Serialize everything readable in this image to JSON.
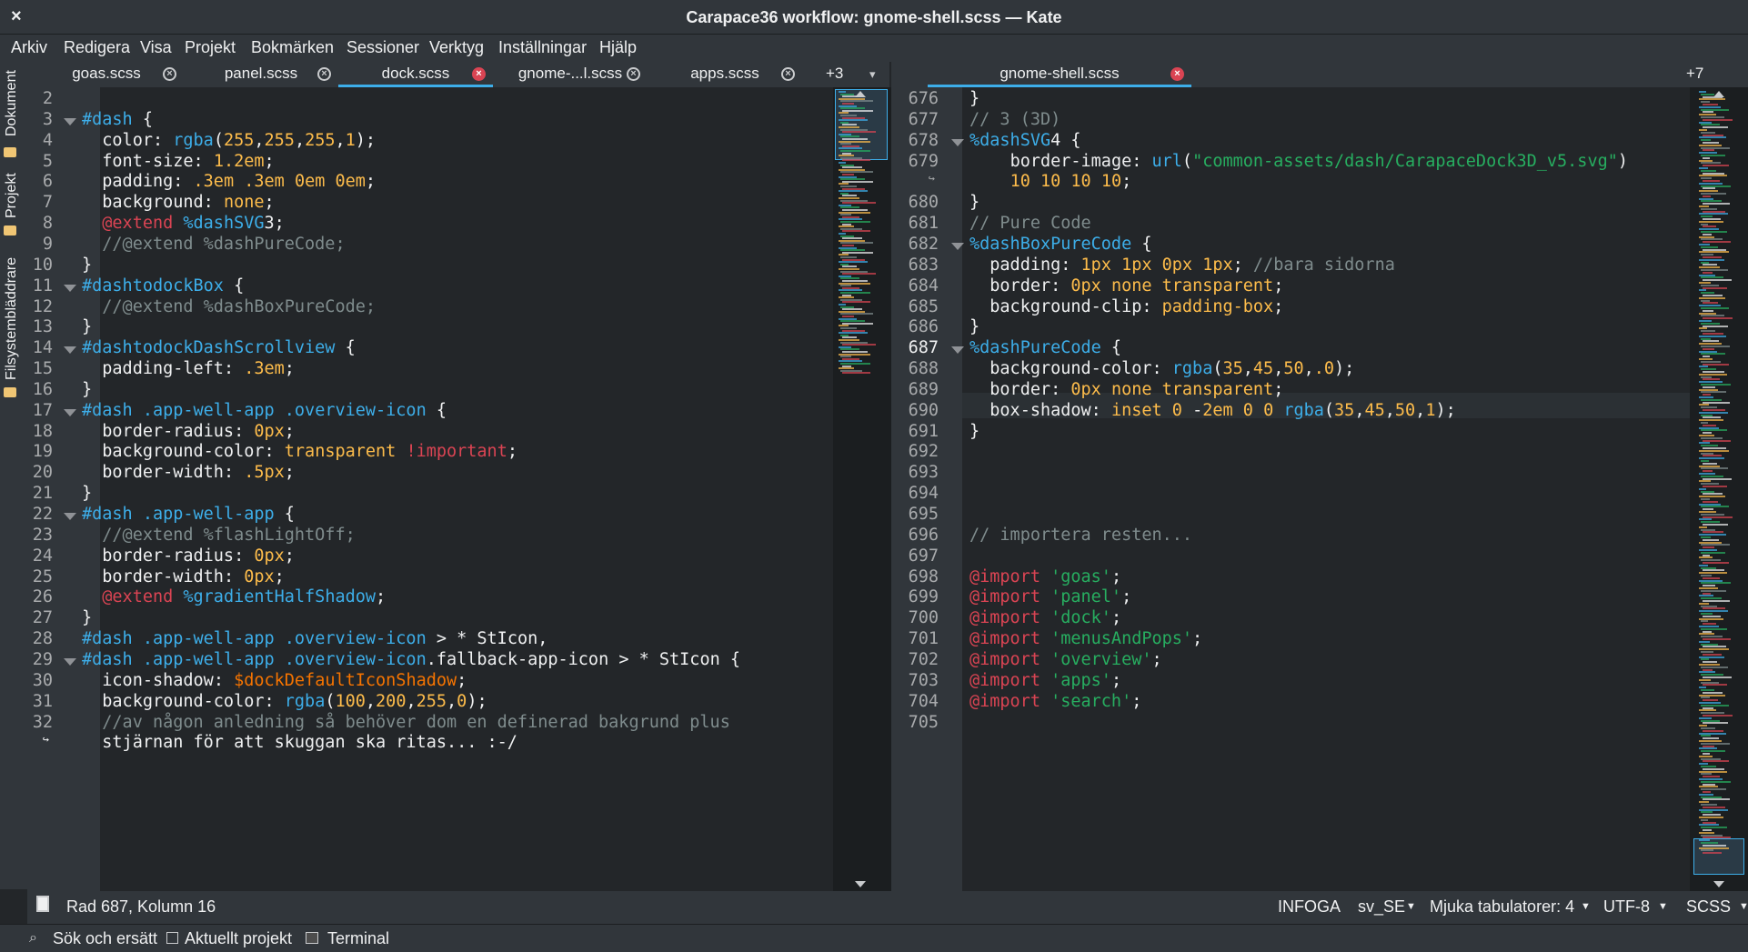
{
  "window": {
    "title": "Carapace36 workflow: gnome-shell.scss — Kate",
    "close": "×"
  },
  "menu": [
    "Arkiv",
    "Redigera",
    "Visa",
    "Projekt",
    "Bokmärken",
    "Sessioner",
    "Verktyg",
    "Inställningar",
    "Hjälp"
  ],
  "sidebar": [
    "Dokument",
    "Projekt",
    "Filsystembläddrare"
  ],
  "left_tabs": [
    {
      "label": "goas.scss",
      "modified": false
    },
    {
      "label": "panel.scss",
      "modified": false
    },
    {
      "label": "dock.scss",
      "modified": true
    },
    {
      "label": "gnome-...l.scss",
      "modified": false
    },
    {
      "label": "apps.scss",
      "modified": false
    }
  ],
  "left_tabs_more": "+3",
  "right_tabs": [
    {
      "label": "gnome-shell.scss",
      "modified": true
    }
  ],
  "right_tabs_more": "+7",
  "left_editor": {
    "lines": [
      {
        "n": "2",
        "t": ""
      },
      {
        "n": "3",
        "t": "#dash {"
      },
      {
        "n": "4",
        "t": "  color: rgba(255,255,255,1);"
      },
      {
        "n": "5",
        "t": "  font-size: 1.2em;"
      },
      {
        "n": "6",
        "t": "  padding: .3em .3em 0em 0em;"
      },
      {
        "n": "7",
        "t": "  background: none;"
      },
      {
        "n": "8",
        "t": "  @extend %dashSVG3;"
      },
      {
        "n": "9",
        "t": "  //@extend %dashPureCode;"
      },
      {
        "n": "10",
        "t": "}"
      },
      {
        "n": "11",
        "t": "#dashtodockBox {"
      },
      {
        "n": "12",
        "t": "  //@extend %dashBoxPureCode;"
      },
      {
        "n": "13",
        "t": "}"
      },
      {
        "n": "14",
        "t": "#dashtodockDashScrollview {"
      },
      {
        "n": "15",
        "t": "  padding-left: .3em;"
      },
      {
        "n": "16",
        "t": "}"
      },
      {
        "n": "17",
        "t": "#dash .app-well-app .overview-icon {"
      },
      {
        "n": "18",
        "t": "  border-radius: 0px;"
      },
      {
        "n": "19",
        "t": "  background-color: transparent !important;"
      },
      {
        "n": "20",
        "t": "  border-width: .5px;"
      },
      {
        "n": "21",
        "t": "}"
      },
      {
        "n": "22",
        "t": "#dash .app-well-app {"
      },
      {
        "n": "23",
        "t": "  //@extend %flashLightOff;"
      },
      {
        "n": "24",
        "t": "  border-radius: 0px;"
      },
      {
        "n": "25",
        "t": "  border-width: 0px;"
      },
      {
        "n": "26",
        "t": "  @extend %gradientHalfShadow;"
      },
      {
        "n": "27",
        "t": "}"
      },
      {
        "n": "28",
        "t": "#dash .app-well-app .overview-icon > * StIcon,"
      },
      {
        "n": "29",
        "t": "#dash .app-well-app .overview-icon.fallback-app-icon > * StIcon {"
      },
      {
        "n": "30",
        "t": "  icon-shadow: $dockDefaultIconShadow;"
      },
      {
        "n": "31",
        "t": "  background-color: rgba(100,200,255,0);"
      },
      {
        "n": "32",
        "t": "  //av någon anledning så behöver dom en definerad bakgrund plus"
      },
      {
        "n": "",
        "t": "  stjärnan för att skuggan ska ritas... :-/"
      }
    ]
  },
  "right_editor": {
    "lines": [
      {
        "n": "676",
        "t": "}"
      },
      {
        "n": "677",
        "t": "// 3 (3D)"
      },
      {
        "n": "678",
        "t": "%dashSVG4 {"
      },
      {
        "n": "679",
        "t": "    border-image: url(\"common-assets/dash/CarapaceDock3D_v5.svg\")"
      },
      {
        "n": "",
        "t": "    10 10 10 10;"
      },
      {
        "n": "680",
        "t": "}"
      },
      {
        "n": "681",
        "t": "// Pure Code"
      },
      {
        "n": "682",
        "t": "%dashBoxPureCode {"
      },
      {
        "n": "683",
        "t": "  padding: 1px 1px 0px 1px; //bara sidorna"
      },
      {
        "n": "684",
        "t": "  border: 0px none transparent;"
      },
      {
        "n": "685",
        "t": "  background-clip: padding-box;"
      },
      {
        "n": "686",
        "t": "}"
      },
      {
        "n": "687",
        "t": "%dashPureCode {"
      },
      {
        "n": "688",
        "t": "  background-color: rgba(35,45,50,.0);"
      },
      {
        "n": "689",
        "t": "  border: 0px none transparent;"
      },
      {
        "n": "690",
        "t": "  box-shadow: inset 0 -2em 0 0 rgba(35,45,50,1);"
      },
      {
        "n": "691",
        "t": "}"
      },
      {
        "n": "692",
        "t": ""
      },
      {
        "n": "693",
        "t": ""
      },
      {
        "n": "694",
        "t": ""
      },
      {
        "n": "695",
        "t": ""
      },
      {
        "n": "696",
        "t": "// importera resten..."
      },
      {
        "n": "697",
        "t": ""
      },
      {
        "n": "698",
        "t": "@import 'goas';"
      },
      {
        "n": "699",
        "t": "@import 'panel';"
      },
      {
        "n": "700",
        "t": "@import 'dock';"
      },
      {
        "n": "701",
        "t": "@import 'menusAndPops';"
      },
      {
        "n": "702",
        "t": "@import 'overview';"
      },
      {
        "n": "703",
        "t": "@import 'apps';"
      },
      {
        "n": "704",
        "t": "@import 'search';"
      },
      {
        "n": "705",
        "t": ""
      }
    ]
  },
  "status": {
    "position": "Rad 687, Kolumn 16",
    "mode": "INFOGA",
    "lang": "sv_SE",
    "tabs": "Mjuka tabulatorer: 4",
    "encoding": "UTF-8",
    "syntax": "SCSS"
  },
  "toolbar": [
    "Sök och ersätt",
    "Aktuellt projekt",
    "Terminal"
  ]
}
